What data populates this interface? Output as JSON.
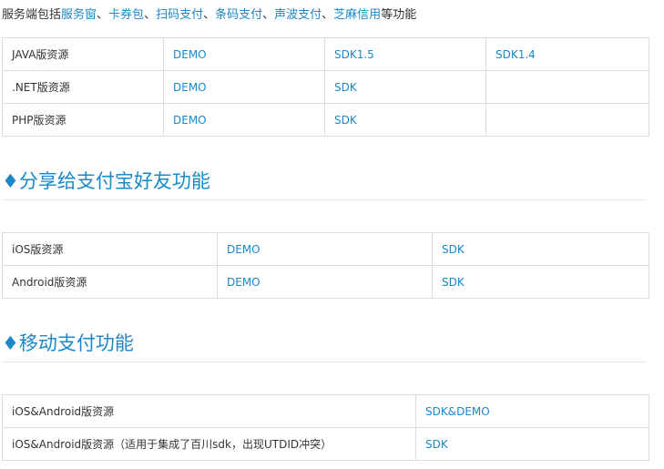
{
  "intro": {
    "prefix": "服务端包括",
    "links": [
      "服务窗",
      "卡券包",
      "扫码支付",
      "条码支付",
      "声波支付",
      "芝麻信用"
    ],
    "separator": "、",
    "suffix": "等功能"
  },
  "table1": {
    "rows": [
      {
        "label": "JAVA版资源",
        "c1": "DEMO",
        "c2": "SDK1.5",
        "c3": "SDK1.4"
      },
      {
        "label": ".NET版资源",
        "c1": "DEMO",
        "c2": "SDK",
        "c3": ""
      },
      {
        "label": "PHP版资源",
        "c1": "DEMO",
        "c2": "SDK",
        "c3": ""
      }
    ]
  },
  "section2": {
    "title": "♦分享给支付宝好友功能"
  },
  "table2": {
    "rows": [
      {
        "label": "iOS版资源",
        "c1": "DEMO",
        "c2": "SDK"
      },
      {
        "label": "Android版资源",
        "c1": "DEMO",
        "c2": "SDK"
      }
    ]
  },
  "section3": {
    "title": "♦移动支付功能"
  },
  "table3": {
    "rows": [
      {
        "label": "iOS&Android版资源",
        "c1": "SDK&DEMO"
      },
      {
        "label": "iOS&Android版资源（适用于集成了百川sdk，出现UTDID冲突）",
        "c1": "SDK"
      }
    ]
  },
  "colors": {
    "link": "#1a88c9",
    "text": "#333333",
    "border": "#dcdcdc"
  }
}
